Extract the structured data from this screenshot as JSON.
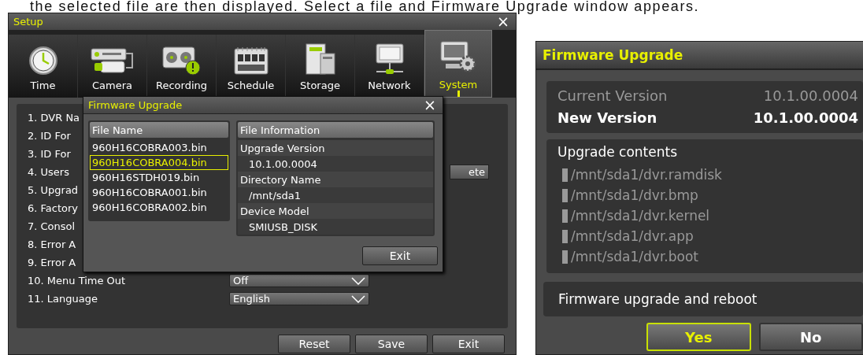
{
  "caption": "the selected file are then displayed. Select a file and Firmware Upgrade window appears.",
  "setup": {
    "title": "Setup",
    "close": "×",
    "tabs": [
      {
        "label": "Time",
        "selected": false
      },
      {
        "label": "Camera",
        "selected": false
      },
      {
        "label": "Recording",
        "selected": false
      },
      {
        "label": "Schedule",
        "selected": false
      },
      {
        "label": "Storage",
        "selected": false
      },
      {
        "label": "Network",
        "selected": false
      },
      {
        "label": "System",
        "selected": true
      }
    ],
    "items": [
      {
        "label": "1. DVR Na"
      },
      {
        "label": "2. ID For"
      },
      {
        "label": "3. ID For"
      },
      {
        "label": "4. Users",
        "button": "ete"
      },
      {
        "label": "5. Upgrad"
      },
      {
        "label": "6. Factory"
      },
      {
        "label": "7. Consol"
      },
      {
        "label": "8. Error A"
      },
      {
        "label": "9. Error A"
      },
      {
        "label": "10. Menu Time Out",
        "dropdown": "Off"
      },
      {
        "label": "11. Language",
        "dropdown": "English"
      }
    ],
    "buttons": [
      "Reset",
      "Save",
      "Exit"
    ]
  },
  "file_dialog": {
    "title": "Firmware Upgrade",
    "close": "×",
    "files_header": "File Name",
    "files": [
      {
        "name": "960H16COBRA003.bin",
        "selected": false
      },
      {
        "name": "960H16COBRA004.bin",
        "selected": true
      },
      {
        "name": "960H16STDH019.bin",
        "selected": false
      },
      {
        "name": "960H16COBRA001.bin",
        "selected": false
      },
      {
        "name": "960H16COBRA002.bin",
        "selected": false
      }
    ],
    "info_header": "File Information",
    "info": [
      {
        "label": "Upgrade Version",
        "value": "10.1.00.0004"
      },
      {
        "label": "Directory Name",
        "value": "/mnt/sda1"
      },
      {
        "label": "Device Model",
        "value": "SMIUSB_DISK"
      }
    ],
    "button": "Exit"
  },
  "confirm_dialog": {
    "title": "Firmware Upgrade",
    "versions": [
      {
        "label": "Current Version",
        "value": "10.1.00.0004",
        "dimmed": true
      },
      {
        "label": "New Version",
        "value": "10.1.00.0004",
        "dimmed": false
      }
    ],
    "contents_title": "Upgrade contents",
    "contents": [
      "/mnt/sda1/dvr.ramdisk",
      "/mnt/sda1/dvr.bmp",
      "/mnt/sda1/dvr.kernel",
      "/mnt/sda1/dvr.app",
      "/mnt/sda1/dvr.boot"
    ],
    "prompt": "Firmware upgrade and reboot",
    "buttons": [
      {
        "label": "Yes",
        "selected": true
      },
      {
        "label": "No",
        "selected": false
      }
    ]
  }
}
